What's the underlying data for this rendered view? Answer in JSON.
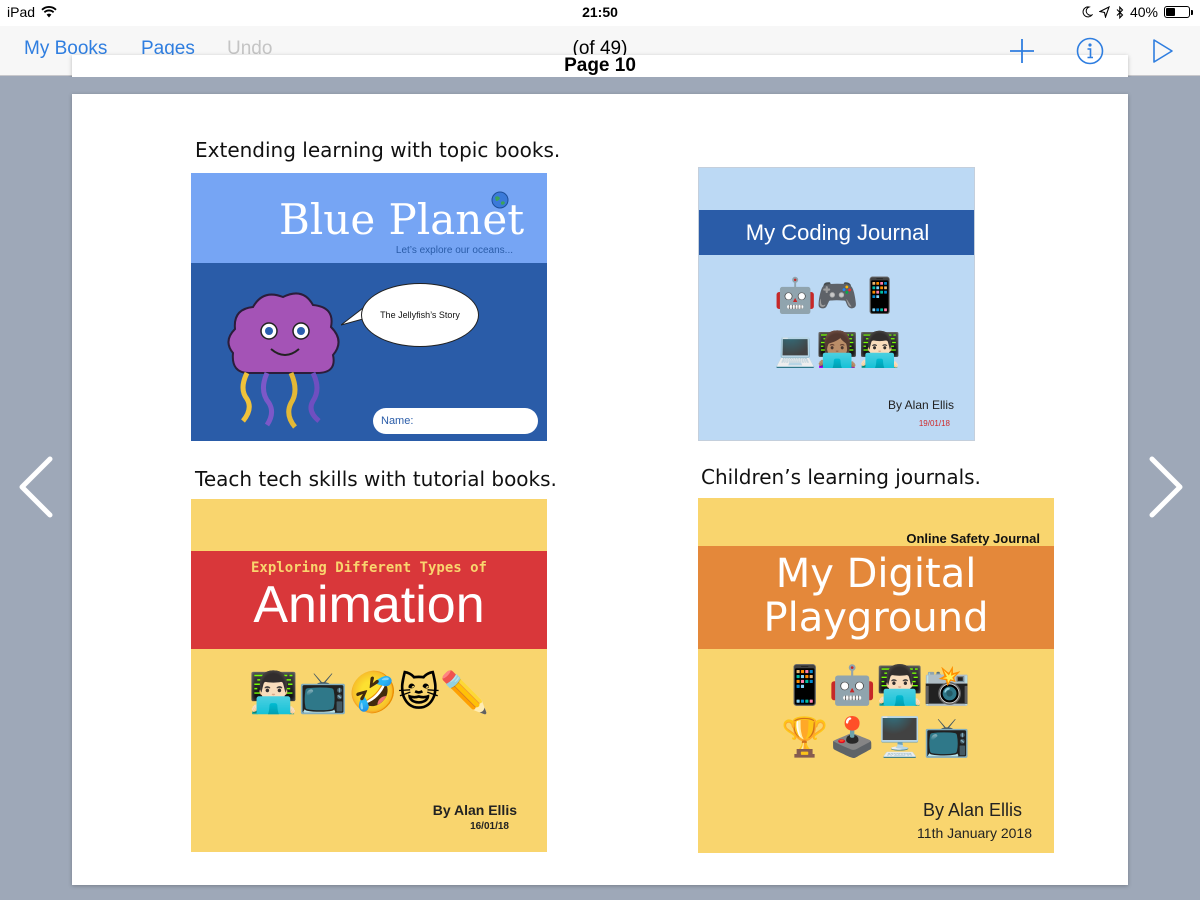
{
  "status_bar": {
    "device": "iPad",
    "time": "21:50",
    "battery": "40%",
    "battery_level": 0.4
  },
  "nav": {
    "my_books": "My Books",
    "pages": "Pages",
    "undo": "Undo",
    "page_label": "Page 10",
    "page_of": "(of 49)"
  },
  "captions": {
    "topic": "Extending learning with topic books.",
    "tutorial": "Teach tech skills with tutorial books.",
    "journals": "Children’s learning journals."
  },
  "books": {
    "blue_planet": {
      "title": "Blue Planet",
      "subtitle": "Let’s explore our oceans...",
      "bubble": "The Jellyfish’s Story",
      "name_field": "Name:"
    },
    "coding_journal": {
      "title": "My Coding Journal",
      "emoji_row1": "🤖🎮📱",
      "emoji_row2": "💻👩🏽‍💻👨🏻‍💻",
      "author": "By Alan Ellis",
      "date": "19/01/18"
    },
    "animation": {
      "subtitle": "Exploring Different Types of",
      "title": "Animation",
      "emoji": "👨🏻‍💻📺🤣😺✏️",
      "author": "By Alan Ellis",
      "date": "16/01/18"
    },
    "digital_playground": {
      "kicker": "Online Safety Journal",
      "title_line1": "My Digital",
      "title_line2": "Playground",
      "emoji_row1": "📱🤖👨🏻‍💻📸",
      "emoji_row2": "🏆🕹️🖥️📺",
      "author": "By Alan Ellis",
      "date": "11th January 2018"
    }
  },
  "colors": {
    "accent": "#2f7ee0",
    "background": "#9ea8b8",
    "blue_cover": "#2a5ca8",
    "yellow_cover": "#f9d56e",
    "red_band": "#d9373a",
    "orange_band": "#e4883a"
  }
}
